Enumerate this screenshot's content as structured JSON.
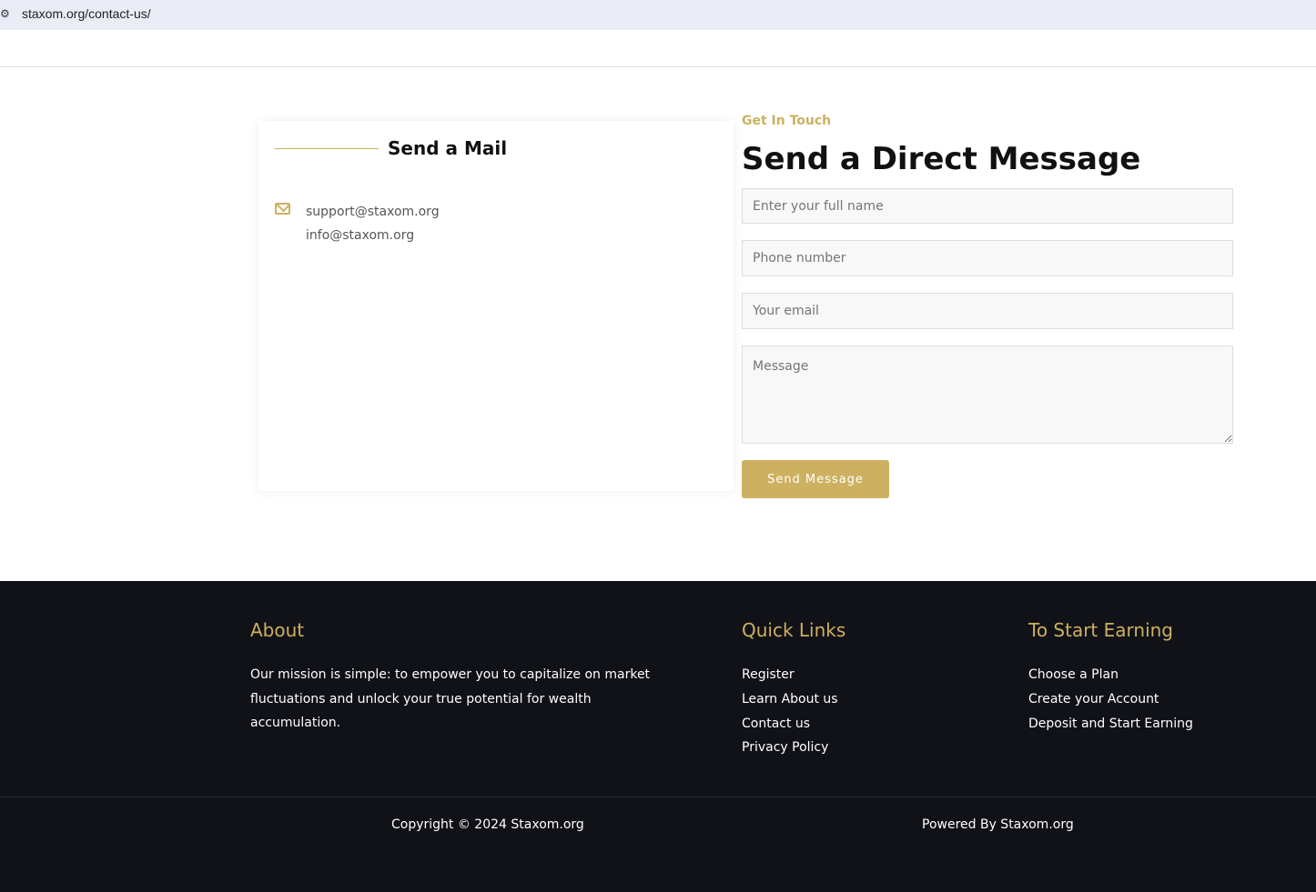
{
  "browser": {
    "url": "staxom.org/contact-us/"
  },
  "mail_card": {
    "title": "Send a Mail",
    "emails": [
      "support@staxom.org",
      "info@staxom.org"
    ]
  },
  "form": {
    "eyebrow": "Get In Touch",
    "title": "Send a Direct Message",
    "name_placeholder": "Enter your full name",
    "phone_placeholder": "Phone number",
    "email_placeholder": "Your email",
    "message_placeholder": "Message",
    "submit": "Send Message"
  },
  "footer": {
    "about": {
      "title": "About",
      "text": "Our mission is simple: to empower you to capitalize on market fluctuations and unlock your true potential for wealth accumulation."
    },
    "quick_links": {
      "title": "Quick Links",
      "items": [
        "Register",
        "Learn About us",
        "Contact us",
        "Privacy Policy"
      ]
    },
    "earning": {
      "title": "To Start Earning",
      "items": [
        "Choose a Plan",
        "Create your Account",
        "Deposit and Start Earning"
      ]
    },
    "copyright": "Copyright © 2024 Staxom.org",
    "powered": "Powered By Staxom.org"
  }
}
